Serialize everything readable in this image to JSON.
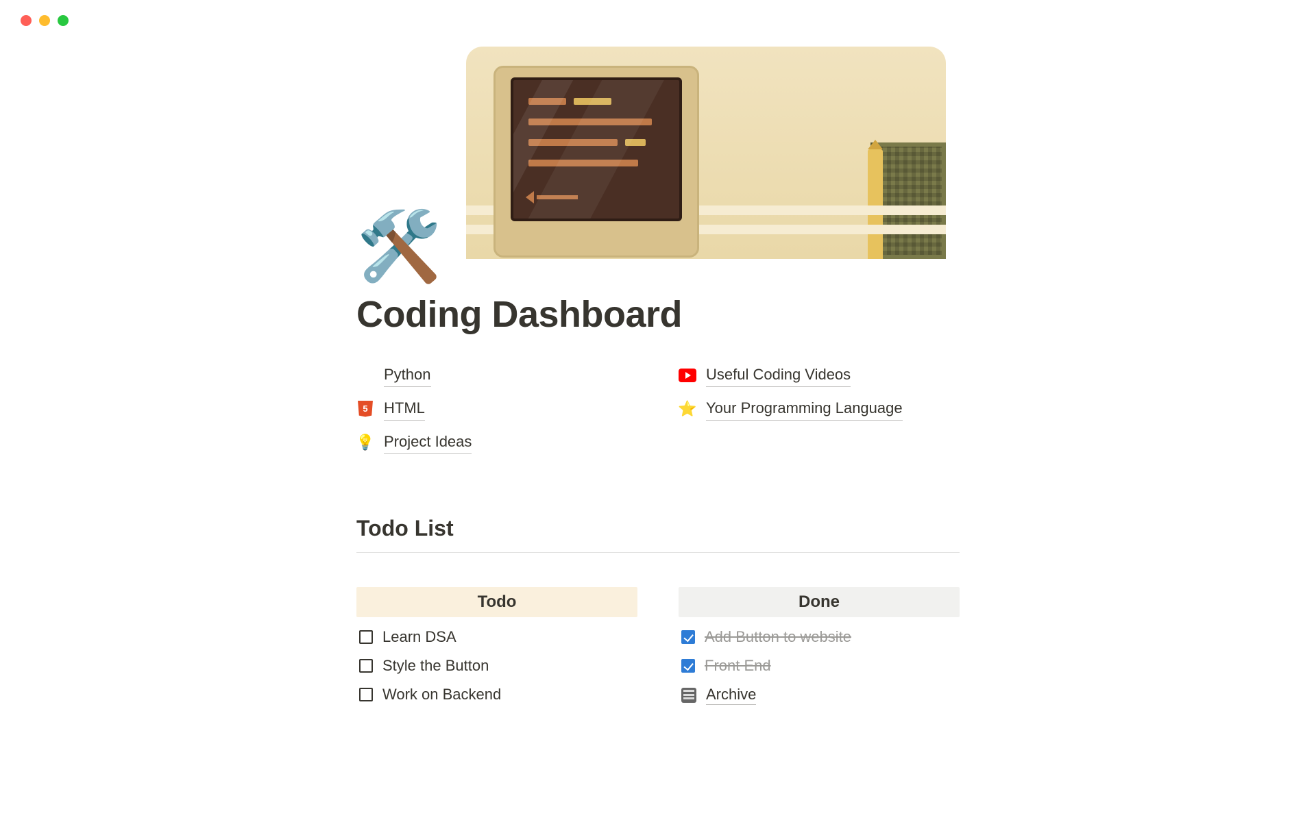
{
  "page": {
    "icon": "🛠️",
    "title": "Coding Dashboard"
  },
  "links": {
    "left": [
      {
        "icon": "",
        "label": "Python"
      },
      {
        "icon": "html5",
        "label": "HTML"
      },
      {
        "icon": "💡",
        "label": "Project Ideas"
      }
    ],
    "right": [
      {
        "icon": "youtube",
        "label": "Useful Coding Videos"
      },
      {
        "icon": "⭐",
        "label": "Your Programming Language"
      }
    ]
  },
  "section": {
    "heading": "Todo List"
  },
  "columns": {
    "todo": {
      "header": "Todo",
      "items": [
        {
          "label": "Learn DSA",
          "checked": false
        },
        {
          "label": "Style the Button",
          "checked": false
        },
        {
          "label": "Work on Backend",
          "checked": false
        }
      ]
    },
    "done": {
      "header": "Done",
      "items": [
        {
          "label": "Add Button to website",
          "checked": true
        },
        {
          "label": "Front End",
          "checked": true
        }
      ],
      "archive_label": "Archive"
    }
  }
}
